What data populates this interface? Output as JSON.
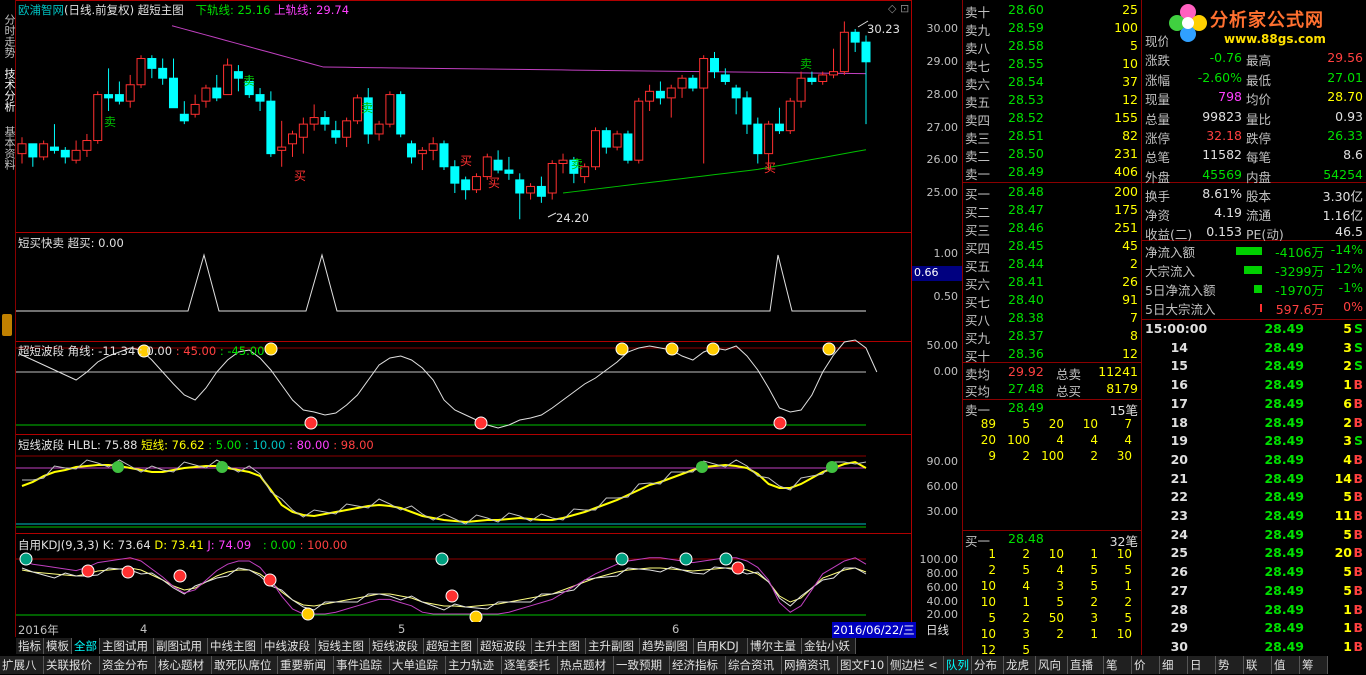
{
  "header": {
    "title": "欧浦智网",
    "subtitle": "(日线.前复权)",
    "indicator": "超短主图",
    "lower_label": "下轨线: 25.16",
    "upper_label": "上轨线: 29.74"
  },
  "left_tabs": [
    "分时走势",
    "技术分析",
    "基本资料"
  ],
  "main_axis": [
    "30.00",
    "29.00",
    "28.00",
    "27.00",
    "26.00",
    "25.00"
  ],
  "annotations": {
    "high": "30.23",
    "low": "24.20"
  },
  "panels": [
    {
      "title": "短买快卖",
      "sub": "超买: 0.00",
      "axis": [
        "1.00",
        "0.50"
      ],
      "marker": "0.66"
    },
    {
      "title": "超短波段",
      "sub": "角线: -11.34",
      "v1": ": 0.00",
      "v2": ": 45.00",
      "v3": ": -45.00",
      "axis": [
        "50.00",
        "0.00"
      ]
    },
    {
      "title": "短线波段",
      "sub": "HLBL: 75.88",
      "v1": "短线: 76.62",
      "v2": ": 5.00",
      "v3": ": 10.00",
      "v4": ": 80.00",
      "v5": ": 98.00",
      "axis": [
        "90.00",
        "60.00",
        "30.00"
      ]
    },
    {
      "title": "自用KDJ(9,3,3)",
      "k": "K: 73.64",
      "d": "D: 73.41",
      "j": "J: 74.09",
      "v1": ": 0.00",
      "v2": ": 100.00",
      "axis": [
        "100.00",
        "80.00",
        "60.00",
        "40.00",
        "20.00"
      ]
    }
  ],
  "date_axis": {
    "labels": [
      "2016年",
      "4",
      "5",
      "6"
    ],
    "current": "2016/06/22/三"
  },
  "period": "日线",
  "sell": [
    {
      "l": "卖十",
      "p": "28.60",
      "v": "25"
    },
    {
      "l": "卖九",
      "p": "28.59",
      "v": "100"
    },
    {
      "l": "卖八",
      "p": "28.58",
      "v": "5"
    },
    {
      "l": "卖七",
      "p": "28.55",
      "v": "10"
    },
    {
      "l": "卖六",
      "p": "28.54",
      "v": "37"
    },
    {
      "l": "卖五",
      "p": "28.53",
      "v": "12"
    },
    {
      "l": "卖四",
      "p": "28.52",
      "v": "155"
    },
    {
      "l": "卖三",
      "p": "28.51",
      "v": "82"
    },
    {
      "l": "卖二",
      "p": "28.50",
      "v": "231"
    },
    {
      "l": "卖一",
      "p": "28.49",
      "v": "406"
    }
  ],
  "buy": [
    {
      "l": "买一",
      "p": "28.48",
      "v": "200"
    },
    {
      "l": "买二",
      "p": "28.47",
      "v": "175"
    },
    {
      "l": "买三",
      "p": "28.46",
      "v": "251"
    },
    {
      "l": "买四",
      "p": "28.45",
      "v": "45"
    },
    {
      "l": "买五",
      "p": "28.44",
      "v": "2"
    },
    {
      "l": "买六",
      "p": "28.41",
      "v": "26"
    },
    {
      "l": "买七",
      "p": "28.40",
      "v": "91"
    },
    {
      "l": "买八",
      "p": "28.38",
      "v": "7"
    },
    {
      "l": "买九",
      "p": "28.37",
      "v": "8"
    },
    {
      "l": "买十",
      "p": "28.36",
      "v": "12"
    }
  ],
  "avg": {
    "sell_avg_label": "卖均",
    "sell_avg": "29.92",
    "total_sell_label": "总卖",
    "total_sell": "11241",
    "buy_avg_label": "买均",
    "buy_avg": "27.48",
    "total_buy_label": "总买",
    "total_buy": "8179"
  },
  "sell1_queue": {
    "label": "卖一",
    "price": "28.49",
    "count": "15笔",
    "rows": [
      [
        "89",
        "5",
        "20",
        "10",
        "7"
      ],
      [
        "20",
        "100",
        "4",
        "4",
        "4"
      ],
      [
        "9",
        "2",
        "100",
        "2",
        "30"
      ]
    ]
  },
  "buy1_queue": {
    "label": "买一",
    "price": "28.48",
    "count": "32笔",
    "rows": [
      [
        "1",
        "2",
        "10",
        "1",
        "10"
      ],
      [
        "2",
        "5",
        "4",
        "5",
        "5"
      ],
      [
        "10",
        "4",
        "3",
        "5",
        "1"
      ],
      [
        "10",
        "1",
        "5",
        "2",
        "2"
      ],
      [
        "5",
        "2",
        "50",
        "3",
        "5"
      ],
      [
        "10",
        "3",
        "2",
        "1",
        "10"
      ],
      [
        "12",
        "5",
        "",
        "",
        ""
      ]
    ]
  },
  "stats": [
    {
      "a": "现价",
      "av": "",
      "b": "",
      "bv": ""
    },
    {
      "a": "涨跌",
      "av": "-0.76",
      "b": "最高",
      "bv": "29.56"
    },
    {
      "a": "涨幅",
      "av": "-2.60%",
      "b": "最低",
      "bv": "27.01"
    },
    {
      "a": "现量",
      "av": "798",
      "b": "均价",
      "bv": "28.70"
    },
    {
      "a": "总量",
      "av": "99823",
      "b": "量比",
      "bv": "0.93"
    },
    {
      "a": "涨停",
      "av": "32.18",
      "b": "跌停",
      "bv": "26.33"
    },
    {
      "a": "总笔",
      "av": "11582",
      "b": "每笔",
      "bv": "8.6"
    },
    {
      "a": "外盘",
      "av": "45569",
      "b": "内盘",
      "bv": "54254"
    },
    {
      "a": "换手",
      "av": "8.61%",
      "b": "股本",
      "bv": "3.30亿"
    },
    {
      "a": "净资",
      "av": "4.19",
      "b": "流通",
      "bv": "1.16亿"
    },
    {
      "a": "收益(二)",
      "av": "0.153",
      "b": "PE(动)",
      "bv": "46.5"
    }
  ],
  "flows": [
    {
      "l": "净流入额",
      "v": "-4106万",
      "p": "-14%"
    },
    {
      "l": "大宗流入",
      "v": "-3299万",
      "p": "-12%"
    },
    {
      "l": "5日净流入额",
      "v": "-1970万",
      "p": "-1%"
    },
    {
      "l": "5日大宗流入",
      "v": "597.6万",
      "p": "0%"
    }
  ],
  "ticks": [
    {
      "t": "15:00:00",
      "p": "28.49",
      "v": "5",
      "d": "S"
    },
    {
      "t": "14",
      "p": "28.49",
      "v": "3",
      "d": "S"
    },
    {
      "t": "15",
      "p": "28.49",
      "v": "2",
      "d": "S"
    },
    {
      "t": "16",
      "p": "28.49",
      "v": "1",
      "d": "B"
    },
    {
      "t": "17",
      "p": "28.49",
      "v": "6",
      "d": "B"
    },
    {
      "t": "18",
      "p": "28.49",
      "v": "2",
      "d": "B"
    },
    {
      "t": "19",
      "p": "28.49",
      "v": "3",
      "d": "S"
    },
    {
      "t": "20",
      "p": "28.49",
      "v": "4",
      "d": "B"
    },
    {
      "t": "21",
      "p": "28.49",
      "v": "14",
      "d": "B"
    },
    {
      "t": "22",
      "p": "28.49",
      "v": "5",
      "d": "B"
    },
    {
      "t": "23",
      "p": "28.49",
      "v": "11",
      "d": "B"
    },
    {
      "t": "24",
      "p": "28.49",
      "v": "5",
      "d": "B"
    },
    {
      "t": "25",
      "p": "28.49",
      "v": "20",
      "d": "B"
    },
    {
      "t": "26",
      "p": "28.49",
      "v": "5",
      "d": "B"
    },
    {
      "t": "27",
      "p": "28.49",
      "v": "5",
      "d": "B"
    },
    {
      "t": "28",
      "p": "28.49",
      "v": "1",
      "d": "B"
    },
    {
      "t": "29",
      "p": "28.49",
      "v": "1",
      "d": "B"
    },
    {
      "t": "30",
      "p": "28.49",
      "v": "1",
      "d": "B"
    }
  ],
  "logo": {
    "text": "分析家公式网",
    "url": "www.88gs.com"
  },
  "tabs_indicator": [
    "指标",
    "模板",
    "全部",
    "主图试用",
    "副图试用",
    "中线主图",
    "中线波段",
    "短线主图",
    "短线波段",
    "超短主图",
    "超短波段",
    "主升主图",
    "主升副图",
    "趋势副图",
    "自用KDJ",
    "博尔主量",
    "金钻小妖"
  ],
  "tabs_bottom": [
    "扩展八",
    "关联报价",
    "资金分布",
    "核心题材",
    "敢死队席位",
    "重要新闻",
    "事件追踪",
    "大单追踪",
    "主力轨迹",
    "逐笔委托",
    "热点题材",
    "一致预期",
    "经济指标",
    "综合资讯",
    "网摘资讯",
    "图文F10",
    "侧边栏 <",
    "队列",
    "分布",
    "龙虎",
    "风向",
    "直播",
    "笔",
    "价",
    "细",
    "日",
    "势",
    "联",
    "值",
    "筹"
  ],
  "colors": {
    "up": "#ff3030",
    "down": "#00ffff",
    "ma": "#c040c0",
    "lower": "#00c000",
    "bg": "#000000",
    "grid": "#8b0000"
  },
  "candles": [
    [
      26.2,
      26.7,
      25.9,
      26.5
    ],
    [
      26.5,
      26.5,
      25.8,
      26.1
    ],
    [
      26.1,
      26.6,
      26,
      26.5
    ],
    [
      26.4,
      27.1,
      26.2,
      26.3
    ],
    [
      26.3,
      26.4,
      25.9,
      26.1
    ],
    [
      26,
      26.6,
      25.9,
      26.3
    ],
    [
      26.3,
      26.8,
      26.1,
      26.6
    ],
    [
      26.6,
      28.1,
      26.5,
      28
    ],
    [
      28,
      28.8,
      27.5,
      27.9
    ],
    [
      28,
      28.4,
      27.7,
      27.8
    ],
    [
      27.8,
      28.6,
      27.6,
      28.3
    ],
    [
      28.3,
      29.2,
      28.2,
      29.1
    ],
    [
      29.1,
      29.2,
      28.5,
      28.8
    ],
    [
      28.8,
      29.1,
      28.3,
      28.5
    ],
    [
      28.5,
      29.1,
      27.6,
      27.6
    ],
    [
      27.4,
      27.8,
      27.1,
      27.2
    ],
    [
      27.4,
      28,
      27.3,
      27.7
    ],
    [
      27.8,
      28.3,
      27.6,
      28.2
    ],
    [
      28.2,
      28.6,
      27.8,
      27.9
    ],
    [
      28,
      29.1,
      28,
      28.9
    ],
    [
      28.7,
      28.9,
      28.1,
      28.5
    ],
    [
      28.4,
      28.6,
      27.9,
      28
    ],
    [
      28,
      28.2,
      27.5,
      27.8
    ],
    [
      27.8,
      28.1,
      26.1,
      26.2
    ],
    [
      26.3,
      27.2,
      25.8,
      26.4
    ],
    [
      26.5,
      26.9,
      26.1,
      26.8
    ],
    [
      26.7,
      27.3,
      26.2,
      27.1
    ],
    [
      27.1,
      27.7,
      26.9,
      27.3
    ],
    [
      27.3,
      27.5,
      26.9,
      27.1
    ],
    [
      26.9,
      27.2,
      26.5,
      26.7
    ],
    [
      26.7,
      27.3,
      26.4,
      27.2
    ],
    [
      27.2,
      28,
      27.1,
      27.9
    ],
    [
      27.9,
      28.2,
      26.5,
      26.8
    ],
    [
      26.8,
      27.2,
      26.6,
      27.1
    ],
    [
      27.1,
      28.1,
      27,
      28
    ],
    [
      28,
      28.1,
      26.7,
      26.8
    ],
    [
      26.5,
      26.6,
      25.9,
      26.1
    ],
    [
      26.2,
      26.4,
      25.7,
      26.3
    ],
    [
      26.3,
      26.7,
      26,
      26.5
    ],
    [
      26.5,
      26.6,
      25.7,
      25.8
    ],
    [
      25.8,
      26,
      25,
      25.3
    ],
    [
      25.4,
      25.5,
      24.8,
      25.1
    ],
    [
      25.1,
      25.6,
      25,
      25.5
    ],
    [
      25.5,
      26.2,
      25.4,
      26.1
    ],
    [
      26,
      26.3,
      25.6,
      25.7
    ],
    [
      25.7,
      26.1,
      25.4,
      25.6
    ],
    [
      25.4,
      25.6,
      24.2,
      25
    ],
    [
      25,
      25.3,
      24.8,
      25.2
    ],
    [
      25.2,
      25.5,
      24.7,
      24.9
    ],
    [
      25,
      26,
      24.8,
      25.9
    ],
    [
      25.9,
      26.2,
      25.6,
      26
    ],
    [
      26,
      26.1,
      25.3,
      25.6
    ],
    [
      25.5,
      25.9,
      25.3,
      25.8
    ],
    [
      25.8,
      27,
      25.7,
      26.9
    ],
    [
      26.9,
      27,
      26.2,
      26.4
    ],
    [
      26.4,
      26.9,
      26.3,
      26.8
    ],
    [
      26.8,
      26.9,
      25.9,
      26
    ],
    [
      26,
      27.9,
      25.9,
      27.8
    ],
    [
      27.8,
      28.3,
      27.5,
      28.1
    ],
    [
      28.1,
      28.4,
      27.7,
      27.9
    ],
    [
      27.9,
      28.3,
      27.3,
      28.2
    ],
    [
      28.2,
      28.6,
      27.9,
      28.5
    ],
    [
      28.5,
      28.6,
      28.1,
      28.2
    ],
    [
      28.2,
      29.2,
      25.9,
      29.1
    ],
    [
      29.1,
      29.3,
      28.5,
      28.7
    ],
    [
      28.6,
      28.8,
      28.3,
      28.4
    ],
    [
      28.2,
      28.3,
      27.4,
      27.9
    ],
    [
      27.9,
      28.1,
      26.8,
      27.1
    ],
    [
      27.1,
      27.3,
      25.9,
      26.2
    ],
    [
      26.2,
      27.2,
      25.7,
      27.1
    ],
    [
      27.1,
      27.6,
      26.8,
      26.9
    ],
    [
      26.9,
      27.9,
      26.8,
      27.8
    ],
    [
      27.8,
      28.7,
      27.6,
      28.5
    ],
    [
      28.5,
      28.7,
      28.3,
      28.4
    ],
    [
      28.4,
      28.7,
      28.3,
      28.6
    ],
    [
      28.6,
      29.4,
      28.5,
      28.7
    ],
    [
      28.7,
      30.23,
      28.6,
      29.9
    ],
    [
      29.9,
      30,
      29.3,
      29.6
    ],
    [
      29.6,
      29.8,
      27.1,
      29
    ]
  ]
}
